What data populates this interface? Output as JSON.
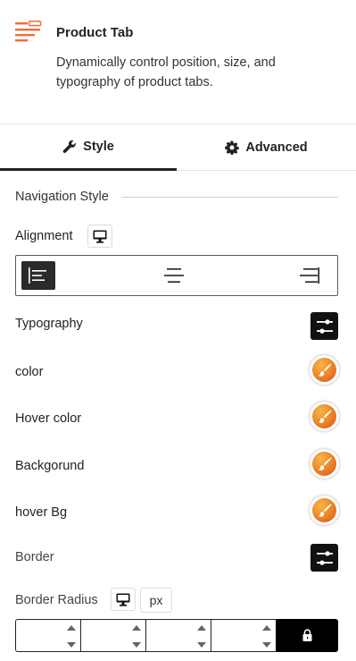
{
  "header": {
    "title": "Product Tab",
    "description": "Dynamically control position, size, and typography of product tabs.",
    "icon": "product-tab-icon",
    "accent_color": "#f26b3a"
  },
  "tabs": [
    {
      "label": "Style",
      "icon": "wrench-icon",
      "active": true
    },
    {
      "label": "Advanced",
      "icon": "gear-icon",
      "active": false
    }
  ],
  "section": {
    "title": "Navigation Style"
  },
  "alignment": {
    "label": "Alignment",
    "device_icon": "desktop-icon",
    "options": [
      "left",
      "center",
      "right"
    ],
    "selected": "left"
  },
  "typography": {
    "label": "Typography",
    "icon": "sliders-icon"
  },
  "colors": [
    {
      "label": "color",
      "icon": "brush-icon"
    },
    {
      "label": "Hover color",
      "icon": "brush-icon"
    },
    {
      "label": "Backgorund",
      "icon": "brush-icon"
    },
    {
      "label": "hover Bg",
      "icon": "brush-icon"
    }
  ],
  "border": {
    "label": "Border",
    "icon": "sliders-icon"
  },
  "border_radius": {
    "label": "Border Radius",
    "device_icon": "desktop-icon",
    "unit": "px",
    "values": [
      "",
      "",
      "",
      ""
    ],
    "lock_icon": "lock-icon"
  }
}
